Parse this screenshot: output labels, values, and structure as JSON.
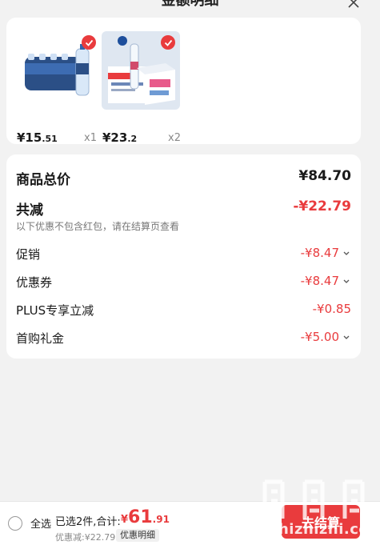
{
  "header": {
    "title": "金额明细"
  },
  "products": [
    {
      "price_int": "¥15",
      "price_dec": ".51",
      "qty": "x1",
      "image_icon": "water-pack-icon"
    },
    {
      "price_int": "¥23",
      "price_dec": ".2",
      "qty": "x2",
      "image_icon": "water-box-icon"
    }
  ],
  "summary": {
    "total_label": "商品总价",
    "total_value": "¥84.70",
    "reduce_label": "共减",
    "reduce_value": "-¥22.79",
    "note": "以下优惠不包含红包，请在结算页查看",
    "items": [
      {
        "label": "促销",
        "value": "-¥8.47"
      },
      {
        "label": "优惠券",
        "value": "-¥8.47"
      },
      {
        "label": "PLUS专享立减",
        "value": "-¥0.85"
      },
      {
        "label": "首购礼金",
        "value": "-¥5.00"
      }
    ]
  },
  "bottom": {
    "select_all": "全选",
    "selected_text": "已选2件,合计:",
    "sum_currency": "¥",
    "sum_int": "61",
    "sum_dec": ".91",
    "discount_text": "优惠减:¥22.79",
    "detail_label": "优惠明细",
    "checkout_label": "去结算"
  },
  "watermark": {
    "text": "zhizhizhi.com"
  },
  "colors": {
    "accent": "#e93b3d",
    "background": "#f2f2f2"
  }
}
